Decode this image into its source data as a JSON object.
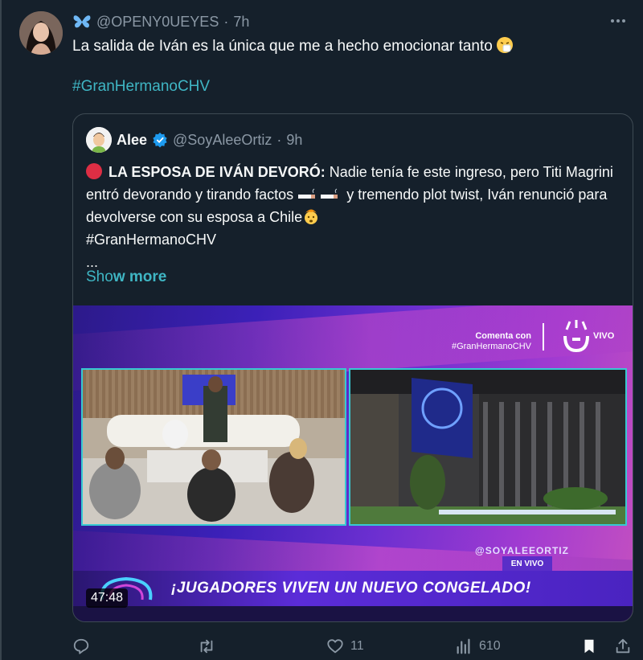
{
  "tweet": {
    "username": "@OPENY0UEYES",
    "separator": "·",
    "time": "7h",
    "text": "La salida de Iván es la única que me a hecho emocionar tanto",
    "hashtag": "#GranHermanoCHV"
  },
  "quote": {
    "name": "Alee",
    "handle": "@SoyAleeOrtiz",
    "separator": "·",
    "time": "9h",
    "headline": "LA ESPOSA DE IVÁN DEVORÓ:",
    "body_part1": "Nadie tenía fe este ingreso, pero Titi Magrini entró devorando y tirando factos",
    "body_part2": "y tremendo plot twist, Iván renunció para devolverse con su esposa a Chile",
    "hashtag": "#GranHermanoCHV",
    "ellipsis": "...",
    "show_more_prefix": "Sho",
    "show_more_bold": "w more"
  },
  "media": {
    "comenta_line1": "Comenta con",
    "comenta_line2": "#GranHermanoCHV",
    "vivo": "VIVO",
    "watermark": "@SOYALEEORTIZ",
    "en_vivo": "EN VIVO",
    "banner": "¡JUGADORES VIVEN UN NUEVO CONGELADO!",
    "duration": "47:48"
  },
  "actions": {
    "likes": "11",
    "views": "610"
  },
  "colors": {
    "background": "#15202b",
    "accent": "#3fb6c4",
    "muted": "#8b98a5",
    "border": "#3e4a53"
  }
}
